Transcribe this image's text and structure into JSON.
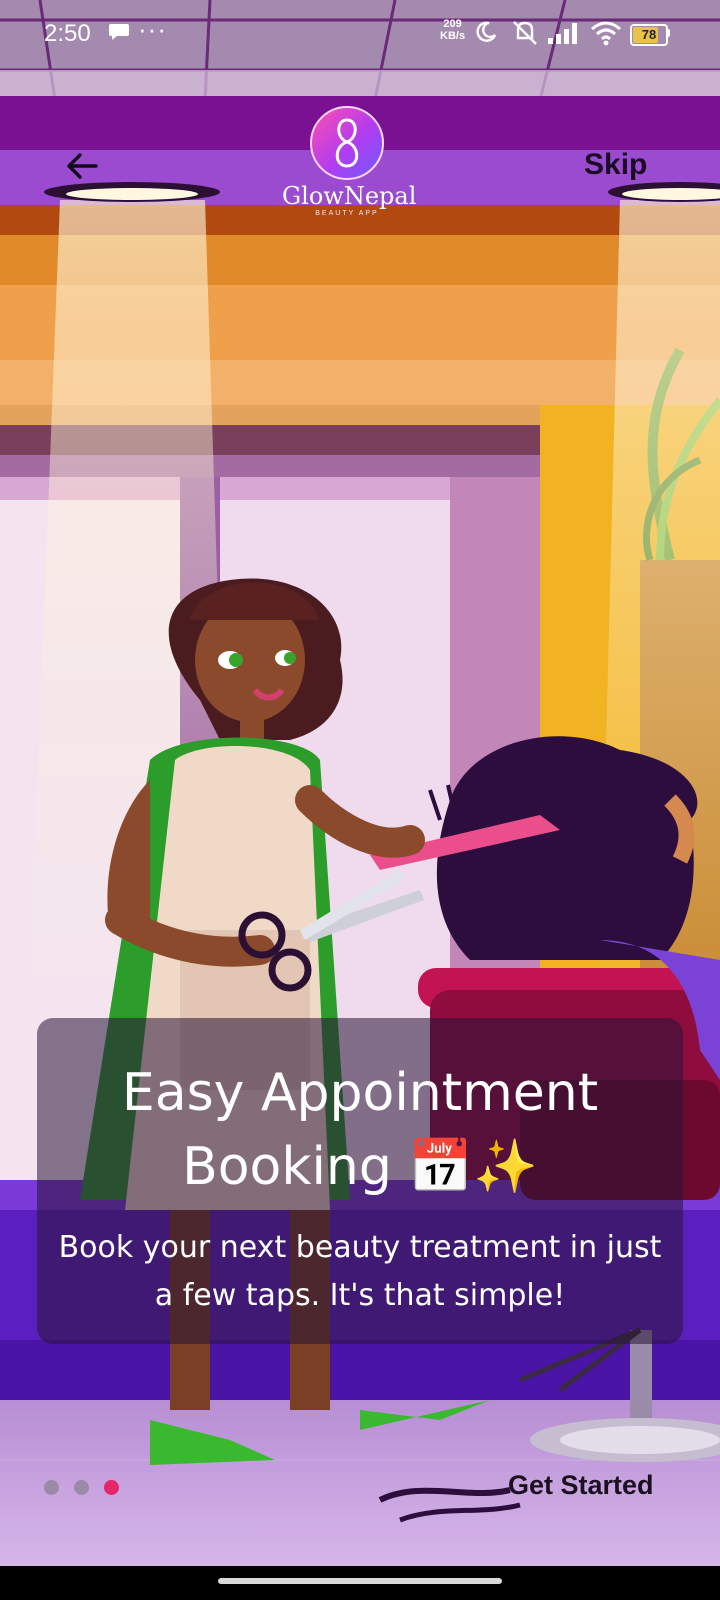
{
  "status_bar": {
    "time": "2:50",
    "more": "···",
    "speed_value": "209",
    "speed_unit": "KB/s",
    "battery": "78",
    "battery_level": 0.78
  },
  "header": {
    "skip_label": "Skip",
    "logo_name": "GlowNepal",
    "logo_tagline": "BEAUTY APP"
  },
  "slide": {
    "title": "Easy Appointment Booking 📅✨",
    "description": "Book your next beauty treatment in just a few taps. It's that simple!"
  },
  "pager": {
    "count": 3,
    "active_index": 2
  },
  "footer": {
    "get_started_label": "Get Started"
  },
  "colors": {
    "accent": "#e5266b",
    "card_overlay": "rgba(40,20,55,0.55)",
    "inactive_dot": "#9a8aa8"
  },
  "icons": [
    "back-arrow-icon",
    "chat-bubble-icon",
    "moon-icon",
    "mute-icon",
    "signal-icon",
    "wifi-icon",
    "battery-icon",
    "logo-icon"
  ]
}
